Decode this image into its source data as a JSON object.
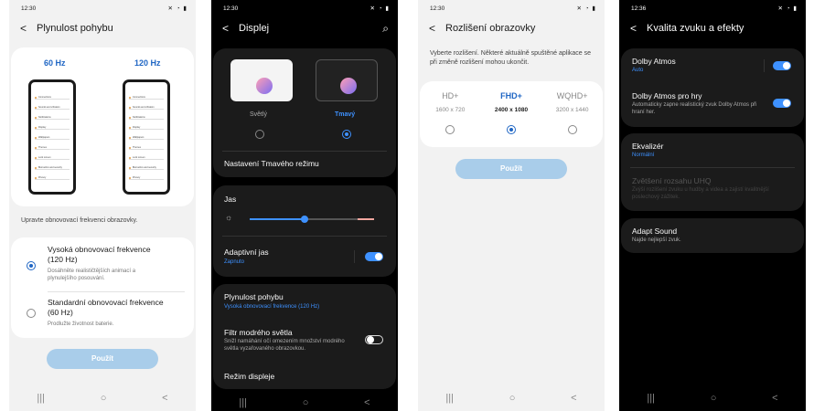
{
  "colors": {
    "accent_dark": "#3e91ff",
    "accent_light": "#1f66c4",
    "button_disabled": "#a9cdea"
  },
  "screen1": {
    "status_time": "12:30",
    "title": "Plynulost pohybu",
    "opt_60": "60 Hz",
    "opt_120": "120 Hz",
    "mini_rows": [
      "Connections",
      "Sounds and vibration",
      "Notifications",
      "Display",
      "Wallpapers",
      "Themes",
      "Lock screen",
      "Biometrics and security",
      "Privacy"
    ],
    "hint": "Upravte obnovovací frekvenci obrazovky.",
    "high_title": "Vysoká obnovovací frekvence (120 Hz)",
    "high_desc": "Dosáhněte realističtějších animací a plynulejšího posouvání.",
    "std_title": "Standardní obnovovací frekvence (60 Hz)",
    "std_desc": "Prodlužte životnost baterie.",
    "apply": "Použít",
    "selected": "high"
  },
  "screen2": {
    "status_time": "12:30",
    "title": "Displej",
    "light_label": "Světlý",
    "dark_label": "Tmavý",
    "dark_mode_settings": "Nastavení Tmavého režimu",
    "brightness_label": "Jas",
    "brightness_level": 0.44,
    "adaptive_label": "Adaptivní jas",
    "adaptive_state": "Zapnuto",
    "motion_label": "Plynulost pohybu",
    "motion_value": "Vysoká obnovovací frekvence (120 Hz)",
    "bluelight_label": "Filtr modrého světla",
    "bluelight_desc": "Snižl namáhání očí omezením množství modrého světla vyzařovaného obrazovkou.",
    "screen_mode_label": "Režim displeje"
  },
  "screen3": {
    "status_time": "12:30",
    "title": "Rozlišení obrazovky",
    "desc": "Vyberte rozlišení. Některé aktuálně spuštěné aplikace se při změně rozlišení mohou ukončit.",
    "options": [
      {
        "name": "HD+",
        "res": "1600 x 720"
      },
      {
        "name": "FHD+",
        "res": "2400 x 1080"
      },
      {
        "name": "WQHD+",
        "res": "3200 x 1440"
      }
    ],
    "selected_index": 1,
    "apply": "Použít"
  },
  "screen4": {
    "status_time": "12:36",
    "title": "Kvalita zvuku a efekty",
    "dolby_label": "Dolby Atmos",
    "dolby_value": "Auto",
    "dolby_games_label": "Dolby Atmos pro hry",
    "dolby_games_desc": "Automaticky zapne realistický zvuk Dolby Atmos při hraní her.",
    "eq_label": "Ekvalizér",
    "eq_value": "Normální",
    "uhq_label": "Zvětšení rozsahu UHQ",
    "uhq_desc": "Zvýší rozlišení zvuku u hudby a videa a zajistí kvalitnější poslechový zážitek.",
    "adapt_label": "Adapt Sound",
    "adapt_desc": "Najde nejlepší zvuk."
  },
  "nav": {
    "recents": "|||",
    "home": "○",
    "back": "<"
  }
}
